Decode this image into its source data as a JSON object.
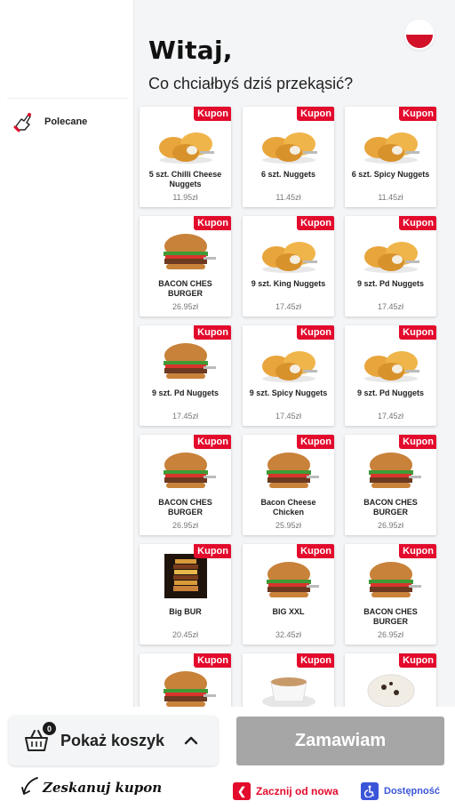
{
  "greeting": "Witaj,",
  "question": "Co chciałbyś dziś przekąsić?",
  "language_flag": "poland-flag-icon",
  "sidebar": {
    "items": [
      {
        "label": "Polecane",
        "icon": "recommended-hand-icon"
      }
    ]
  },
  "badge_label": "Kupon",
  "products": [
    {
      "name": "5 szt. Chilli Cheese Nuggets",
      "price": "11.95zł",
      "img": "nuggets"
    },
    {
      "name": "6 szt. Nuggets",
      "price": "11.45zł",
      "img": "nuggets"
    },
    {
      "name": "6 szt. Spicy Nuggets",
      "price": "11.45zł",
      "img": "nuggets"
    },
    {
      "name": "BACON CHES BURGER",
      "price": "26.95zł",
      "img": "burger"
    },
    {
      "name": "9 szt. King Nuggets",
      "price": "17.45zł",
      "img": "nuggets"
    },
    {
      "name": "9 szt. Pd Nuggets",
      "price": "17.45zł",
      "img": "nuggets"
    },
    {
      "name": "9 szt. Pd Nuggets",
      "price": "17.45zł",
      "img": "burger"
    },
    {
      "name": "9 szt. Spicy Nuggets",
      "price": "17.45zł",
      "img": "nuggets"
    },
    {
      "name": "9 szt. Pd Nuggets",
      "price": "17.45zł",
      "img": "nuggets"
    },
    {
      "name": "BACON CHES BURGER",
      "price": "26.95zł",
      "img": "burger"
    },
    {
      "name": "Bacon Cheese Chicken",
      "price": "25.95zł",
      "img": "burger"
    },
    {
      "name": "BACON CHES BURGER",
      "price": "26.95zł",
      "img": "burger"
    },
    {
      "name": "Big BUR",
      "price": "20.45zł",
      "img": "tower"
    },
    {
      "name": "BIG XXL",
      "price": "32.45zł",
      "img": "burger"
    },
    {
      "name": "BACON CHES BURGER",
      "price": "26.95zł",
      "img": "burger"
    },
    {
      "name": "",
      "price": "",
      "img": "burger"
    },
    {
      "name": "",
      "price": "",
      "img": "coffee"
    },
    {
      "name": "",
      "price": "",
      "img": "icecream"
    }
  ],
  "cart": {
    "label": "Pokaż koszyk",
    "count": "0"
  },
  "order_button": "Zamawiam",
  "scan_coupon": "Zeskanuj kupon",
  "restart": "Zacznij od nowa",
  "accessibility": "Dostępność",
  "colors": {
    "accent": "#e30a2c",
    "order_disabled": "#a6a6a6",
    "accessibility": "#3b55d9"
  }
}
